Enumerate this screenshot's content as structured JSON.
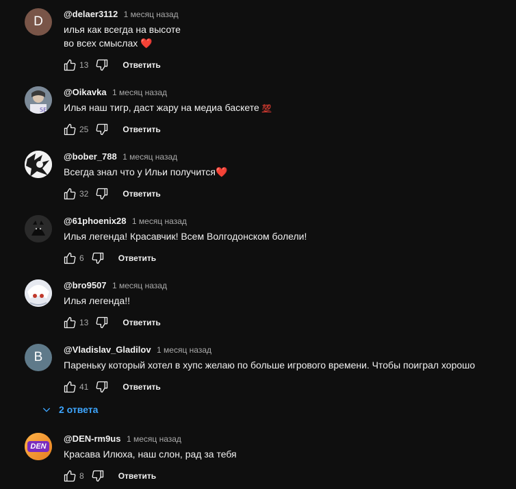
{
  "reply_label": "Ответить",
  "comments": [
    {
      "author": "@delaer3112",
      "time": "1 месяц назад",
      "lines": [
        "илья как всегда на высоте",
        "во всех смыслах"
      ],
      "emoji": "❤️",
      "likes": "13",
      "avatar_letter": "D",
      "avatar_color": "#795548"
    },
    {
      "author": "@Oikavka",
      "time": "1 месяц назад",
      "lines": [
        "Илья наш тигр, даст жару на медиа баскете"
      ],
      "emoji": "💯",
      "likes": "25"
    },
    {
      "author": "@bober_788",
      "time": "1 месяц назад",
      "lines": [
        "Всегда знал что у Ильи получится"
      ],
      "emoji": "❤️",
      "likes": "32"
    },
    {
      "author": "@61phoenix28",
      "time": "1 месяц назад",
      "lines": [
        "Илья легенда! Красавчик! Всем Волгодонском болели!"
      ],
      "likes": "6"
    },
    {
      "author": "@bro9507",
      "time": "1 месяц назад",
      "lines": [
        "Илья легенда!!"
      ],
      "likes": "13"
    },
    {
      "author": "@Vladislav_Gladilov",
      "time": "1 месяц назад",
      "lines": [
        "Пареньку который хотел в хупс желаю по больше игрового времени. Чтобы поиграл хорошо"
      ],
      "likes": "41",
      "avatar_letter": "B",
      "avatar_color": "#5f7a8a",
      "replies_label": "2 ответа"
    },
    {
      "author": "@DEN-rm9us",
      "time": "1 месяц назад",
      "lines": [
        "Красава Илюха, наш слон, рад за тебя"
      ],
      "likes": "8",
      "avatar_text": "DEN"
    }
  ],
  "colors": {
    "background": "#0f0f0f",
    "link": "#3ea6ff",
    "secondary_text": "#aaaaaa"
  }
}
